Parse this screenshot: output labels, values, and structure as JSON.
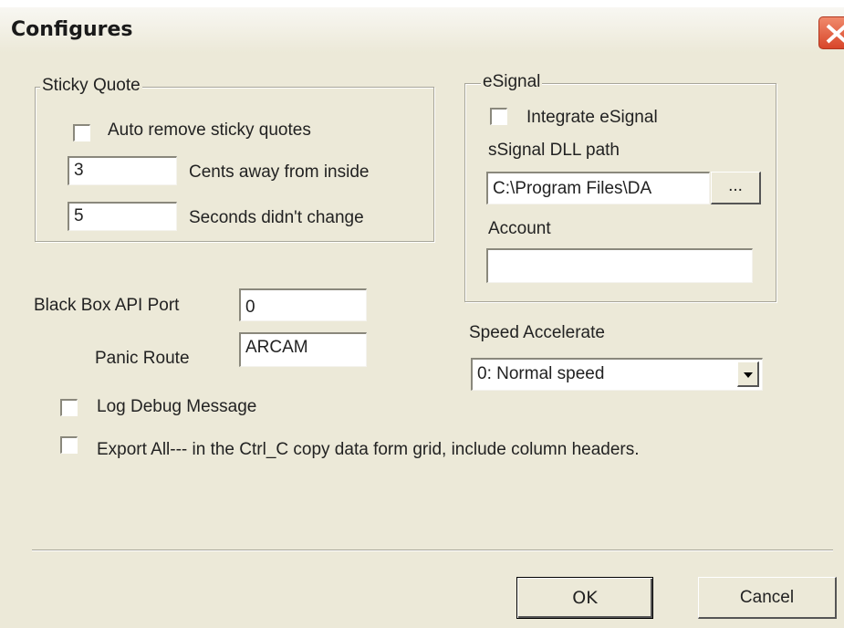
{
  "title": "Configures",
  "sticky_quote": {
    "legend": "Sticky Quote",
    "auto_remove_label": "Auto remove sticky quotes",
    "cents_value": "3",
    "cents_label": "Cents away from inside",
    "seconds_value": "5",
    "seconds_label": "Seconds didn't change"
  },
  "esignal": {
    "legend": "eSignal",
    "integrate_label": "Integrate eSignal",
    "dll_path_label": "sSignal DLL path",
    "dll_path_value": "C:\\Program Files\\DA",
    "browse_label": "...",
    "account_label": "Account",
    "account_value": ""
  },
  "black_box": {
    "api_port_label": "Black Box API Port",
    "api_port_value": "0",
    "panic_route_label": "Panic Route",
    "panic_route_value": "ARCAM"
  },
  "speed": {
    "label": "Speed Accelerate",
    "selected": "0: Normal speed"
  },
  "options": {
    "log_debug_label": "Log Debug Message",
    "export_all_label": "Export All--- in the Ctrl_C copy data form grid,  include column headers."
  },
  "buttons": {
    "ok": "OK",
    "cancel": "Cancel"
  }
}
